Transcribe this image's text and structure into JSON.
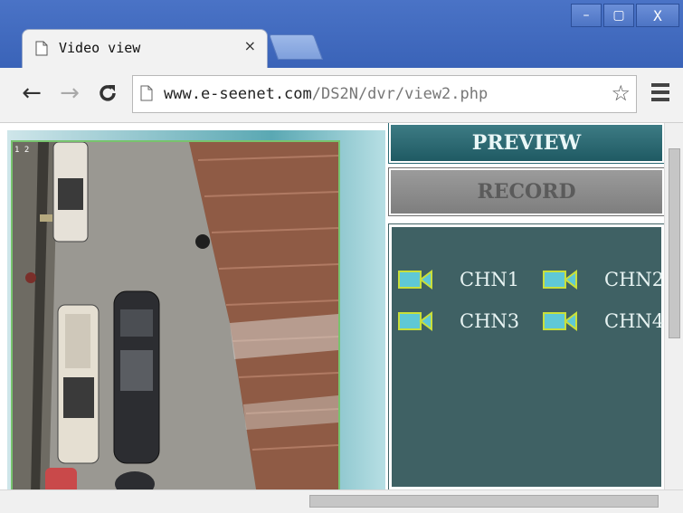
{
  "window": {
    "minimize_glyph": "–",
    "restore_glyph": "▢",
    "close_glyph": "X"
  },
  "tab": {
    "title": "Video view",
    "close_glyph": "×"
  },
  "toolbar": {
    "back_glyph": "←",
    "forward_glyph": "→",
    "reload_glyph": "C",
    "url_host": "www.e-seenet.com",
    "url_path": "/DS2N/dvr/view2.php",
    "star_glyph": "☆"
  },
  "camera": {
    "overlay_text": "1 2"
  },
  "panel": {
    "preview_label": "PREVIEW",
    "record_label": "RECORD",
    "channels": [
      {
        "label": "CHN1"
      },
      {
        "label": "CHN2"
      },
      {
        "label": "CHN3"
      },
      {
        "label": "CHN4"
      }
    ]
  },
  "colors": {
    "titlebar": "#3a63b8",
    "preview_bg": "#1f5a63",
    "record_bg": "#7e7e7e",
    "channel_panel_bg": "#3f6164",
    "camera_icon": "#5fc8d6"
  }
}
